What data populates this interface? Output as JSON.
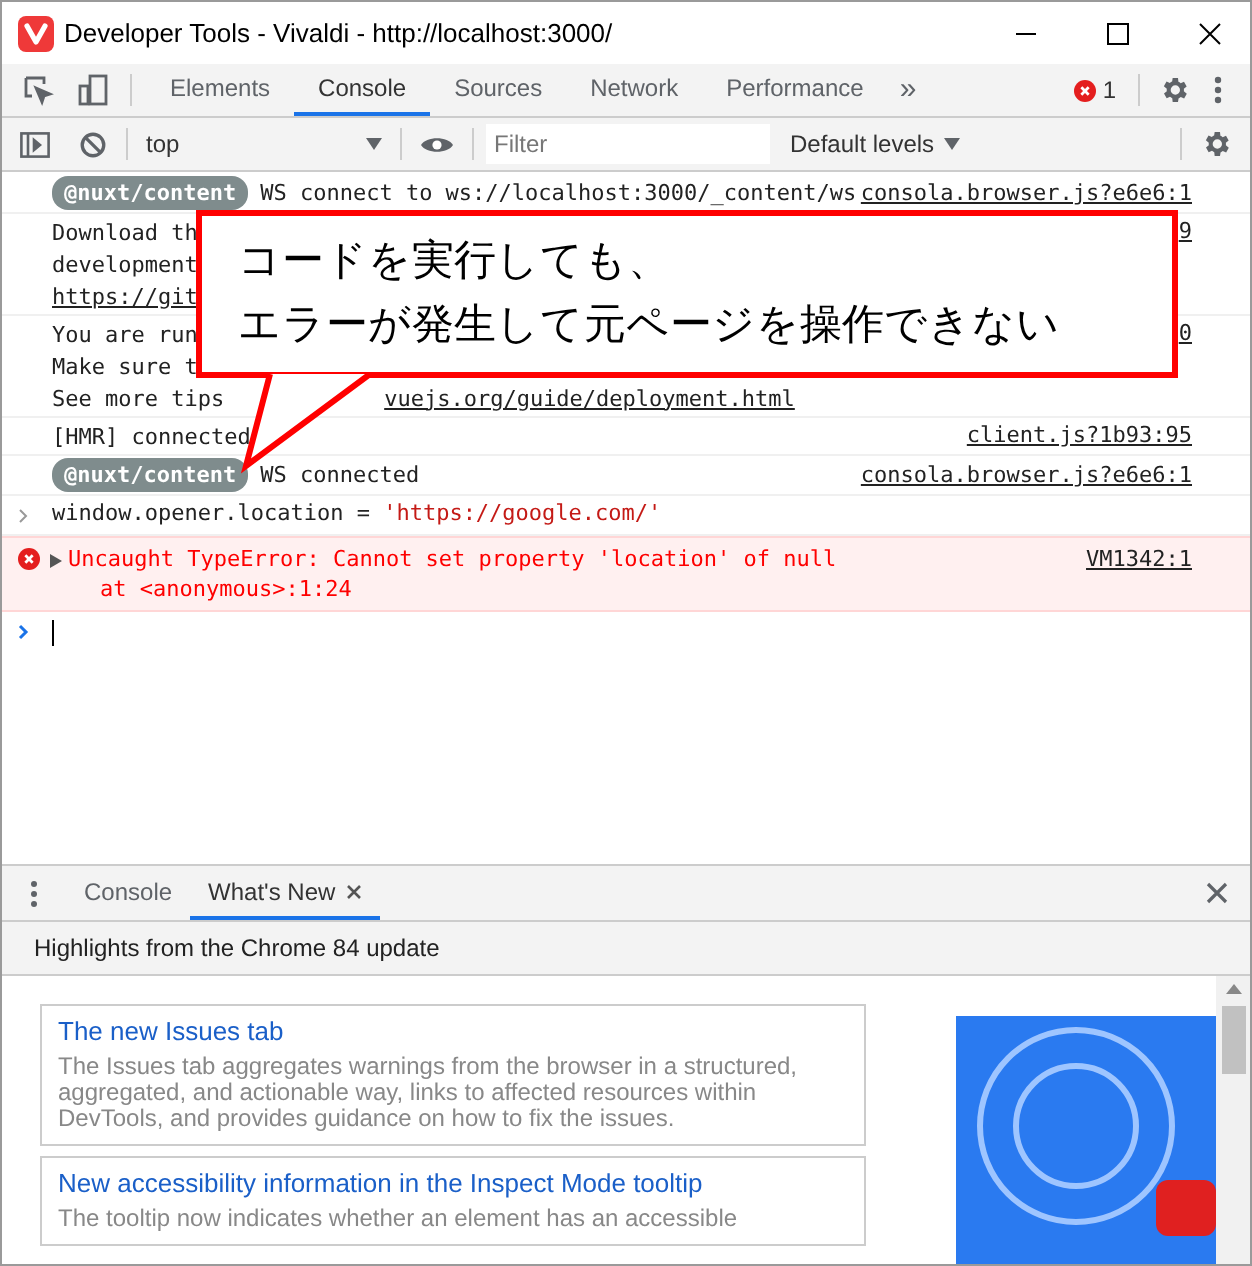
{
  "window": {
    "title": "Developer Tools - Vivaldi - http://localhost:3000/"
  },
  "main_tabs": [
    {
      "label": "Elements",
      "selected": false
    },
    {
      "label": "Console",
      "selected": true
    },
    {
      "label": "Sources",
      "selected": false
    },
    {
      "label": "Network",
      "selected": false
    },
    {
      "label": "Performance",
      "selected": false
    }
  ],
  "overflow": "»",
  "error_count": "1",
  "console_toolbar": {
    "context": "top",
    "filter_placeholder": "Filter",
    "levels": "Default levels"
  },
  "messages": [
    {
      "kind": "badge",
      "badge": "@nuxt/content",
      "lines": [
        {
          "text": "WS connect to ws://localhost:3000/_content/ws"
        }
      ],
      "source": "consola.browser.js?e6e6:1"
    },
    {
      "kind": "plain",
      "lines": [
        {
          "text": "Download th"
        },
        {
          "text": "development"
        },
        {
          "text": "https://git",
          "link": true
        }
      ],
      "source": "9"
    },
    {
      "kind": "plain",
      "lines": [
        {
          "text": "You are run"
        },
        {
          "text": "Make sure t"
        },
        {
          "text": "See more tips",
          "tail_link": "vuejs.org/guide/deployment.html"
        }
      ],
      "source": "0"
    },
    {
      "kind": "plain",
      "lines": [
        {
          "text": "[HMR] connected"
        }
      ],
      "source": "client.js?1b93:95"
    },
    {
      "kind": "badge",
      "badge": "@nuxt/content",
      "lines": [
        {
          "text": "WS connected"
        }
      ],
      "source": "consola.browser.js?e6e6:1"
    }
  ],
  "command": {
    "prefix": "window.opener.location = ",
    "string": "'https://google.com/'"
  },
  "error": {
    "text": "Uncaught TypeError: Cannot set property 'location' of null",
    "stack": "at <anonymous>:1:24",
    "source": "VM1342:1",
    "expanded": false
  },
  "callout": {
    "lines": [
      "コードを実行しても、",
      "エラーが発生して元ページを操作できない"
    ]
  },
  "drawer": {
    "tabs": [
      {
        "label": "Console",
        "selected": false,
        "closable": false
      },
      {
        "label": "What's New",
        "selected": true,
        "closable": true
      }
    ],
    "header": "Highlights from the Chrome 84 update",
    "articles": [
      {
        "title": "The new Issues tab",
        "body": "The Issues tab aggregates warnings from the browser in a structured, aggregated, and actionable way, links to affected resources within DevTools, and provides guidance on how to fix the issues."
      },
      {
        "title": "New accessibility information in the Inspect Mode tooltip",
        "body": "The tooltip now indicates whether an element has an accessible"
      }
    ]
  }
}
